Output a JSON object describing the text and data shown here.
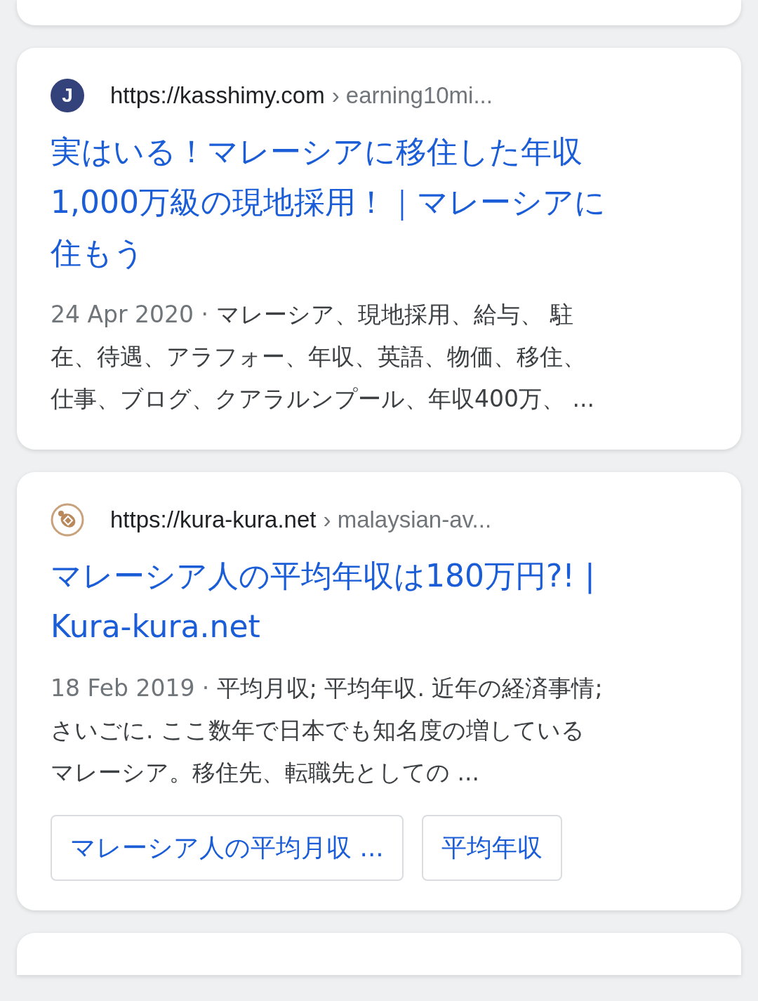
{
  "results": [
    {
      "favicon": {
        "kind": "letter",
        "letter": "J"
      },
      "site": "https://kasshimy.com",
      "path": "› earning10mi...",
      "title_lines": [
        "実はいる！マレーシアに移住した年収",
        "1,000万級の現地採用！｜マレーシアに",
        "住もう"
      ],
      "date": "24 Apr 2020 · ",
      "snippet_lines": [
        "マレーシア、現地採用、給与、 駐",
        "在、待遇、アラフォー、年収、英語、物価、移住、",
        "仕事、ブログ、クアラルンプール、年収400万、 ..."
      ]
    },
    {
      "favicon": {
        "kind": "emblem"
      },
      "site": "https://kura-kura.net",
      "path": "› malaysian-av...",
      "title_lines": [
        "マレーシア人の平均年収は180万円?! |",
        "Kura-kura.net"
      ],
      "date": "18 Feb 2019 · ",
      "snippet_lines": [
        "平均月収; 平均年収. 近年の経済事情;",
        "さいごに. ここ数年で日本でも知名度の増している",
        "マレーシア。移住先、転職先としての ..."
      ],
      "chips": [
        "マレーシア人の平均月収 ...",
        "平均年収"
      ]
    }
  ]
}
